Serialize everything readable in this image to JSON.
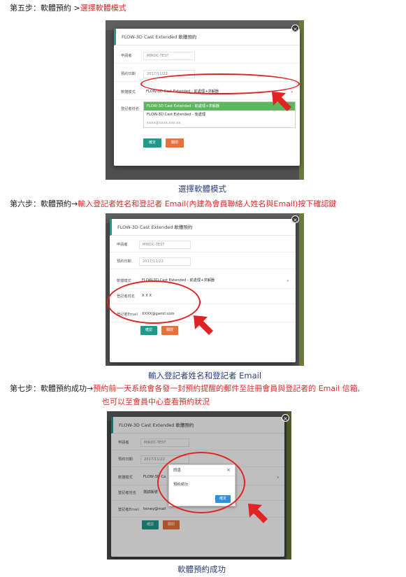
{
  "step5": {
    "prefix": "第五步：軟體預約 ",
    "highlight": "選擇軟體模式",
    "caption": "選擇軟體模式",
    "modal": {
      "title": "FLOW-3D Cast Extended 軟體預約",
      "rows": [
        {
          "label": "申請者",
          "value": "MIRDC-TEST"
        },
        {
          "label": "預約日期",
          "value": "2017/11/22"
        },
        {
          "label": "軟體模式",
          "value": "FLOW-3D Cast Extended - 前處理+求解器"
        },
        {
          "label": "登記者姓名",
          "value": ""
        },
        {
          "label": "登記者Email",
          "value": ""
        }
      ],
      "dropdown_options": [
        "FLOW-3D Cast Extended - 前處理+求解器",
        "FLOW-3D Cast Extended - 後處理",
        "xxxx@xxxx.xxx.xx"
      ],
      "confirm": "確定",
      "cancel": "關閉"
    }
  },
  "step6": {
    "prefix": "第六步：軟體預約",
    "highlight": "輸入登記者姓名和登記者 Email(內建為會員聯絡人姓名與Email)按下確認鍵",
    "caption": "輸入登記者姓名和登記者 Email",
    "modal": {
      "title": "FLOW-3D Cast Extended 軟體預約",
      "rows": [
        {
          "label": "申請者",
          "value": "MIRDC-TEST"
        },
        {
          "label": "預約日期",
          "value": "2017/11/22"
        },
        {
          "label": "軟體模式",
          "value": "FLOW-3D Cast Extended - 前處理+求解器"
        },
        {
          "label": "登記者姓名",
          "value": "X X X"
        },
        {
          "label": "登記者Email",
          "value": "XXXX@gamil.com"
        }
      ],
      "confirm": "確認",
      "cancel": "關閉"
    }
  },
  "step7": {
    "prefix": "第七步：軟體預約成功",
    "highlight_line1": "預約前一天系統會各發一封預約提醒的郵件至註冊會員與登記者的 Email 信箱,",
    "highlight_line2": "也可以至會員中心查看預約狀況",
    "caption": "軟體預約成功",
    "modal": {
      "title": "FLOW-3D Cast Extended 軟體預約",
      "rows": [
        {
          "label": "申請者",
          "value": "MIRDC-TEST"
        },
        {
          "label": "預約日期",
          "value": "2017/11/22"
        },
        {
          "label": "軟體模式",
          "value": "FLOW-3D Ca"
        },
        {
          "label": "登記者姓名",
          "value": "測試帳號"
        },
        {
          "label": "登記者Email",
          "value": "honey@mail"
        }
      ],
      "confirm": "確認",
      "cancel": "關閉"
    },
    "alert": {
      "title": "訊息",
      "message": "預約成功",
      "ok": "確定",
      "close": "×"
    }
  },
  "colors": {
    "annotation_red": "#e02323",
    "caption_blue": "#2b3d7f",
    "teal": "#1f9a8a",
    "orange": "#e8713a"
  }
}
